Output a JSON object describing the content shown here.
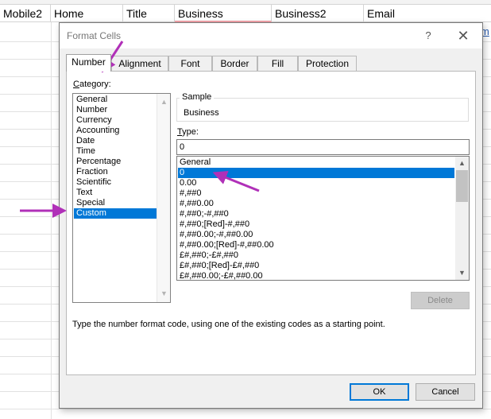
{
  "sheet": {
    "headers": [
      "Mobile2",
      "Home",
      "Title",
      "Business",
      "Business2",
      "Email"
    ],
    "link_fragment": "m"
  },
  "dialog": {
    "title": "Format Cells",
    "help_glyph": "?",
    "close_glyph": "✕",
    "tabs": [
      {
        "label": "Number",
        "active": true
      },
      {
        "label": "Alignment",
        "active": false
      },
      {
        "label": "Font",
        "active": false
      },
      {
        "label": "Border",
        "active": false
      },
      {
        "label": "Fill",
        "active": false
      },
      {
        "label": "Protection",
        "active": false
      }
    ],
    "category": {
      "label": "Category:",
      "items": [
        "General",
        "Number",
        "Currency",
        "Accounting",
        "Date",
        "Time",
        "Percentage",
        "Fraction",
        "Scientific",
        "Text",
        "Special",
        "Custom"
      ],
      "selected": "Custom"
    },
    "sample": {
      "legend": "Sample",
      "value": "Business"
    },
    "type": {
      "label": "Type:",
      "value": "0",
      "formats": [
        "General",
        "0",
        "0.00",
        "#,##0",
        "#,##0.00",
        "#,##0;-#,##0",
        "#,##0;[Red]-#,##0",
        "#,##0.00;-#,##0.00",
        "#,##0.00;[Red]-#,##0.00",
        "£#,##0;-£#,##0",
        "£#,##0;[Red]-£#,##0",
        "£#,##0.00;-£#,##0.00"
      ],
      "selected": "0"
    },
    "delete_label": "Delete",
    "description": "Type the number format code, using one of the existing codes as a starting point.",
    "ok_label": "OK",
    "cancel_label": "Cancel"
  },
  "colors": {
    "selection": "#0078d7",
    "annotation_arrow": "#b030b8",
    "header_underline": "#f3a3a9"
  }
}
